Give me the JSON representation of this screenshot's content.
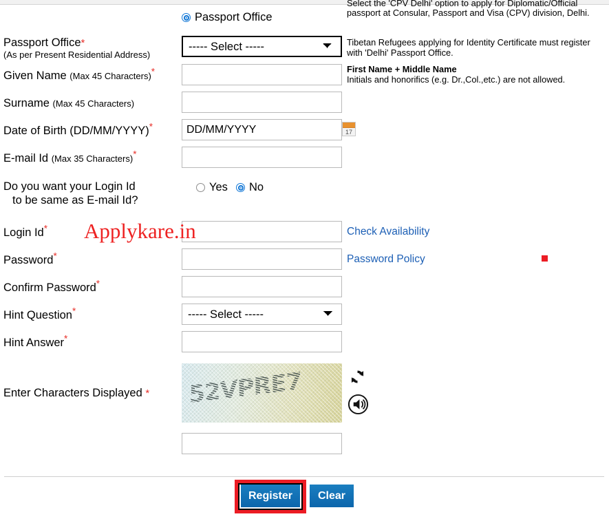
{
  "form": {
    "office_type_radio": {
      "label": "Passport Office",
      "selected": true
    },
    "fields": {
      "passport_office": {
        "label": "Passport Office",
        "sublabel": "(As per Present Residential Address)",
        "required": "*",
        "value": "----- Select -----",
        "options": [
          "----- Select -----"
        ],
        "note": "Tibetan Refugees applying for Identity Certificate must register with 'Delhi' Passport Office."
      },
      "given_name": {
        "label": "Given Name",
        "hint": "(Max 45 Characters)",
        "required": "*",
        "value": "",
        "note_title": "First Name + Middle Name",
        "note_body": "Initials and honorifics (e.g. Dr.,Col.,etc.) are not allowed."
      },
      "surname": {
        "label": "Surname",
        "hint": "(Max 45 Characters)",
        "required": "",
        "value": ""
      },
      "date_of_birth": {
        "label": "Date of Birth (DD/MM/YYYY)",
        "required": "*",
        "value": "DD/MM/YYYY",
        "calendar_day": "17"
      },
      "email_id": {
        "label": "E-mail Id",
        "hint": "(Max 35 Characters)",
        "required": "*",
        "value": ""
      },
      "login_same_as_email": {
        "label_line1": "Do you want your Login Id",
        "label_line2": "to be same as E-mail Id?",
        "yes_label": "Yes",
        "no_label": "No",
        "selected": "No"
      },
      "login_id": {
        "label": "Login Id",
        "required": "*",
        "value": "",
        "link": "Check Availability"
      },
      "password": {
        "label": "Password",
        "required": "*",
        "value": "",
        "link": "Password Policy"
      },
      "confirm_password": {
        "label": "Confirm Password",
        "required": "*",
        "value": ""
      },
      "hint_question": {
        "label": "Hint Question",
        "required": "*",
        "value": "----- Select -----",
        "options": [
          "----- Select -----"
        ]
      },
      "hint_answer": {
        "label": "Hint Answer",
        "required": "*",
        "value": ""
      },
      "captcha": {
        "label": "Enter Characters Displayed",
        "required": "*",
        "code_text": "52VPRE7",
        "value": "",
        "refresh_icon": "refresh-icon",
        "audio_icon": "speaker-icon"
      }
    },
    "top_note": {
      "line_clipped": "Select the 'CPV Delhi' option to apply for Diplomatic/Official",
      "line_visible": "passport at Consular, Passport and Visa (CPV) division, Delhi."
    },
    "actions": {
      "register": "Register",
      "clear": "Clear"
    }
  },
  "watermark": {
    "text": "Applykare.in"
  },
  "colors": {
    "required_red": "#e8302a",
    "link_blue": "#1c5fb5",
    "button_blue": "#0c66ac",
    "highlight_red": "#ec1c24",
    "radio_blue": "#1076d6",
    "calendar_orange": "#e8912e"
  }
}
